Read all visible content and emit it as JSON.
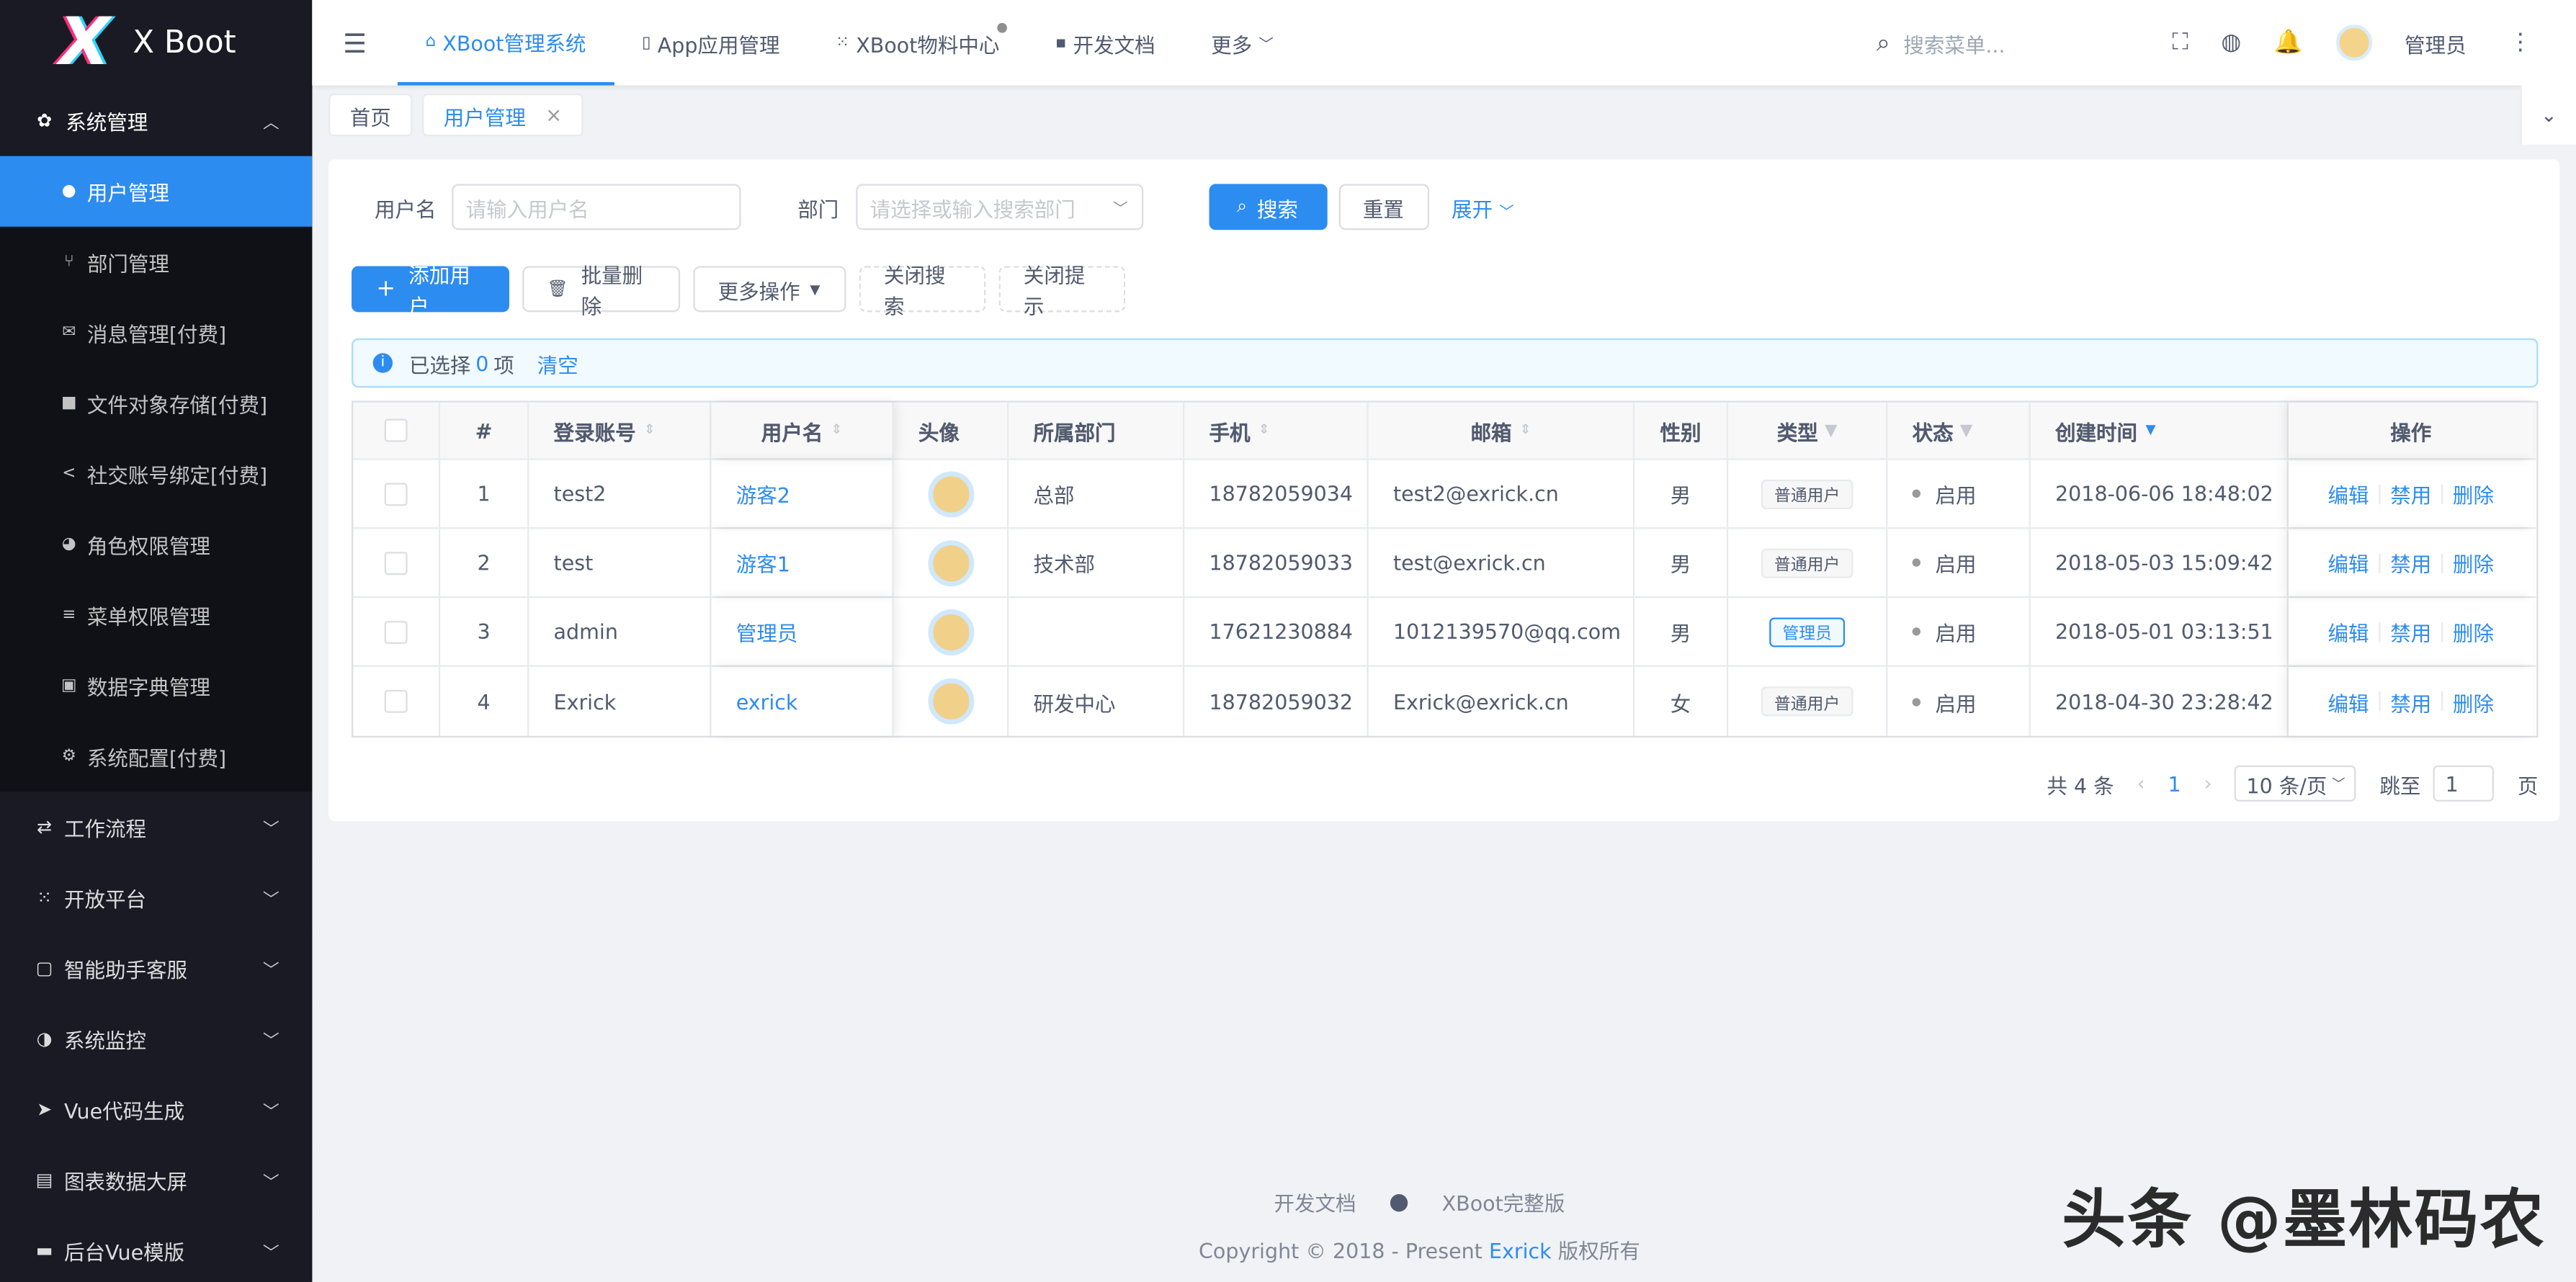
{
  "app": {
    "logo_mark": "X",
    "name": "X Boot"
  },
  "sidebar": {
    "open_group": {
      "label": "系统管理",
      "icon": "gear-icon"
    },
    "sub_items": [
      {
        "label": "用户管理",
        "icon": "user-icon",
        "active": true
      },
      {
        "label": "部门管理",
        "icon": "branch-icon"
      },
      {
        "label": "消息管理[付费]",
        "icon": "mail-icon"
      },
      {
        "label": "文件对象存储[付费]",
        "icon": "folder-icon"
      },
      {
        "label": "社交账号绑定[付费]",
        "icon": "share-icon"
      },
      {
        "label": "角色权限管理",
        "icon": "users-icon"
      },
      {
        "label": "菜单权限管理",
        "icon": "list-icon"
      },
      {
        "label": "数据字典管理",
        "icon": "book-icon"
      },
      {
        "label": "系统配置[付费]",
        "icon": "cog-icon"
      }
    ],
    "groups": [
      {
        "label": "工作流程",
        "icon": "flow-icon"
      },
      {
        "label": "开放平台",
        "icon": "grid-icon"
      },
      {
        "label": "智能助手客服",
        "icon": "chat-icon"
      },
      {
        "label": "系统监控",
        "icon": "monitor-icon"
      },
      {
        "label": "Vue代码生成",
        "icon": "send-icon"
      },
      {
        "label": "图表数据大屏",
        "icon": "chart-icon"
      },
      {
        "label": "后台Vue模版",
        "icon": "template-icon"
      }
    ]
  },
  "header": {
    "nav": [
      {
        "label": "XBoot管理系统",
        "icon": "home-icon",
        "active": true
      },
      {
        "label": "App应用管理",
        "icon": "mobile-icon"
      },
      {
        "label": "XBoot物料中心",
        "icon": "apps-icon",
        "dot": true
      },
      {
        "label": "开发文档",
        "icon": "doc-icon"
      },
      {
        "label": "更多",
        "icon": "chevron-down-icon"
      }
    ],
    "search_placeholder": "搜索菜单...",
    "user": "管理员"
  },
  "tags": [
    {
      "label": "首页"
    },
    {
      "label": "用户管理",
      "active": true,
      "close": "×"
    }
  ],
  "search": {
    "username_label": "用户名",
    "username_placeholder": "请输入用户名",
    "dept_label": "部门",
    "dept_placeholder": "请选择或输入搜索部门",
    "search_btn": "搜索",
    "reset_btn": "重置",
    "expand": "展开"
  },
  "actions": {
    "add": "添加用户",
    "batch_delete": "批量删除",
    "more": "更多操作",
    "close_search": "关闭搜索",
    "close_tip": "关闭提示"
  },
  "alert": {
    "prefix": "已选择",
    "count": "0",
    "suffix": "项",
    "clear": "清空"
  },
  "table": {
    "columns": [
      "#",
      "登录账号",
      "用户名",
      "头像",
      "所属部门",
      "手机",
      "邮箱",
      "性别",
      "类型",
      "状态",
      "创建时间",
      "操作"
    ],
    "rows": [
      {
        "idx": "1",
        "account": "test2",
        "name": "游客2",
        "dept": "总部",
        "phone": "18782059034",
        "email": "test2@exrick.cn",
        "gender": "男",
        "type": "普通用户",
        "type_admin": false,
        "status": "启用",
        "created": "2018-06-06 18:48:02"
      },
      {
        "idx": "2",
        "account": "test",
        "name": "游客1",
        "dept": "技术部",
        "phone": "18782059033",
        "email": "test@exrick.cn",
        "gender": "男",
        "type": "普通用户",
        "type_admin": false,
        "status": "启用",
        "created": "2018-05-03 15:09:42"
      },
      {
        "idx": "3",
        "account": "admin",
        "name": "管理员",
        "dept": "",
        "phone": "17621230884",
        "email": "1012139570@qq.com",
        "gender": "男",
        "type": "管理员",
        "type_admin": true,
        "status": "启用",
        "created": "2018-05-01 03:13:51"
      },
      {
        "idx": "4",
        "account": "Exrick",
        "name": "exrick",
        "dept": "研发中心",
        "phone": "18782059032",
        "email": "Exrick@exrick.cn",
        "gender": "女",
        "type": "普通用户",
        "type_admin": false,
        "status": "启用",
        "created": "2018-04-30 23:28:42"
      }
    ],
    "ops": {
      "edit": "编辑",
      "disable": "禁用",
      "delete": "删除"
    }
  },
  "pager": {
    "total": "共 4 条",
    "page": "1",
    "size": "10 条/页",
    "jump_label": "跳至",
    "jump_value": "1",
    "page_unit": "页"
  },
  "footer": {
    "docs": "开发文档",
    "full": "XBoot完整版",
    "copy_prefix": "Copyright © 2018 - Present",
    "author": "Exrick",
    "copy_suffix": "版权所有"
  },
  "watermark": "头条 @墨林码农",
  "colors": {
    "primary": "#2d8cf0",
    "sidebar": "#191a23",
    "sidebar_sub": "#101117"
  }
}
